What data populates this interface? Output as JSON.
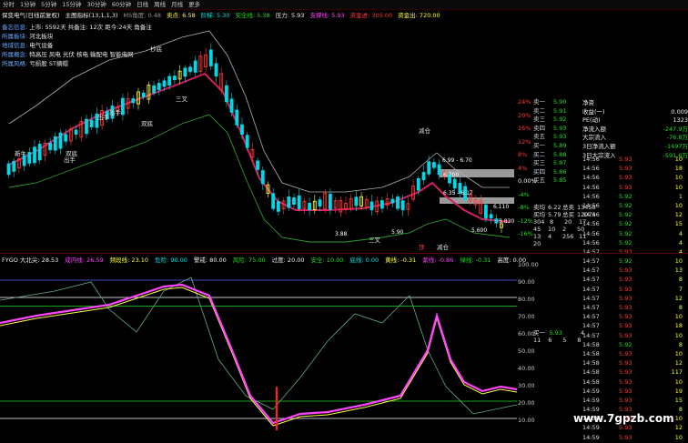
{
  "tabs": [
    "分时",
    "1分钟",
    "5分钟",
    "15分钟",
    "30分钟",
    "60分钟",
    "日线",
    "周线",
    "月线",
    "更多"
  ],
  "infobar": [
    {
      "text": "保变电气(日线前复权)",
      "c": "white"
    },
    {
      "text": "主图指标(13,1,1,3)",
      "c": "white"
    },
    {
      "text": "MS角度: 0.48",
      "c": "gray"
    },
    {
      "text": "卖点: 6.58",
      "c": "yellow"
    },
    {
      "text": "阶梯: 5.30",
      "c": "cyan"
    },
    {
      "text": "安全线: 5.38",
      "c": "green"
    },
    {
      "text": "压力: 5.93",
      "c": "white"
    },
    {
      "text": "支撑线: 5.93",
      "c": "magenta"
    },
    {
      "text": "资金进: 305.00",
      "c": "red"
    },
    {
      "text": "资金出: 720.00",
      "c": "yellow"
    }
  ],
  "notes": [
    {
      "k": "备忘信息:",
      "v": "上市: 5592天  共备注: 12次  距今:24天 角备注"
    },
    {
      "k": "所属板块:",
      "v": "河北板块"
    },
    {
      "k": "地域信息:",
      "v": "电气设备"
    },
    {
      "k": "所属概念:",
      "v": "特高压 风电 光伏 核电 输配电 智能电网"
    },
    {
      "k": "所属风格:",
      "v": "亏损股 ST摘帽"
    }
  ],
  "annotations": [
    "抄底",
    "三叉",
    "双底",
    "出手",
    "新牛",
    "双底",
    "出手",
    "出手",
    "减仓",
    "三叉",
    "顶",
    "减仓"
  ],
  "price_labels": [
    "6.99 - 6.70",
    "6.700",
    "6.35 - 6.17",
    "6.110",
    "5.830",
    "5.600",
    "3.88",
    "5.90"
  ],
  "pct_axis": [
    "24%",
    "20%",
    "16%",
    "12%",
    "8%",
    "4%",
    "0.00%",
    "-4%",
    "-8%",
    "-12%",
    "-16%"
  ],
  "book_sell": [
    {
      "label": "卖五",
      "price": "5.93"
    },
    {
      "label": "卖四",
      "price": "5.93"
    },
    {
      "label": "卖三",
      "price": "5.92"
    },
    {
      "label": "卖二",
      "price": "5.91"
    },
    {
      "label": "卖一",
      "price": "5.90"
    }
  ],
  "book_buy": [
    {
      "label": "买一",
      "price": "5.89"
    },
    {
      "label": "买二",
      "price": "5.88"
    },
    {
      "label": "买三",
      "price": "5.87"
    },
    {
      "label": "买四",
      "price": "5.86"
    },
    {
      "label": "买五",
      "price": "5.85"
    }
  ],
  "stats": [
    {
      "k": "净资",
      "v": ""
    },
    {
      "k": "收益(一)",
      "v": "0.009"
    },
    {
      "k": "PE(动)",
      "v": "1323"
    },
    {
      "k": "净流入额",
      "v": "-247.9万"
    },
    {
      "k": "大宗流入",
      "v": "-76.8万"
    },
    {
      "k": "3日净流入额",
      "v": "-1497万"
    },
    {
      "k": "3日大宗流入",
      "v": "-591.6万"
    }
  ],
  "summary": [
    {
      "a": "卖均",
      "b": "6.22",
      "c": "总卖",
      "d": "13458"
    },
    {
      "a": "买均",
      "b": "5.79",
      "c": "总买",
      "d": "12074"
    },
    {
      "a": "304",
      "b": "8",
      "c": "20",
      "d": "17"
    },
    {
      "a": "45",
      "b": "10",
      "c": "2",
      "d": "50"
    },
    {
      "a": "13",
      "b": "4",
      "c": "256",
      "d": "11"
    },
    {
      "a": "20",
      "b": "",
      "c": "",
      "d": ""
    }
  ],
  "bottom_left": [
    {
      "a": "买一",
      "b": "5.93",
      "c": "",
      "d": "4"
    },
    {
      "a": "11",
      "b": "6",
      "c": "5",
      "d": "8"
    }
  ],
  "ticks": [
    {
      "t": "14:56",
      "p": "5.93",
      "v": "10"
    },
    {
      "t": "14:56",
      "p": "5.93",
      "v": "18"
    },
    {
      "t": "14:56",
      "p": "5.93",
      "v": "10"
    },
    {
      "t": "14:56",
      "p": "5.93",
      "v": "10"
    },
    {
      "t": "14:56",
      "p": "5.92",
      "v": "1"
    },
    {
      "t": "14:56",
      "p": "5.92",
      "v": "10"
    },
    {
      "t": "14:56",
      "p": "5.92",
      "v": "12"
    },
    {
      "t": "14:56",
      "p": "5.92",
      "v": "15"
    },
    {
      "t": "14:56",
      "p": "5.92",
      "v": "4"
    },
    {
      "t": "14:56",
      "p": "5.92",
      "v": "4"
    },
    {
      "t": "14:57",
      "p": "5.93",
      "v": "4"
    },
    {
      "t": "14:57",
      "p": "5.92",
      "v": "10"
    },
    {
      "t": "14:57",
      "p": "5.93",
      "v": "13"
    },
    {
      "t": "14:57",
      "p": "5.93",
      "v": "8"
    },
    {
      "t": "14:57",
      "p": "5.93",
      "v": "7"
    },
    {
      "t": "14:57",
      "p": "5.93",
      "v": "12"
    },
    {
      "t": "14:57",
      "p": "5.93",
      "v": "8"
    },
    {
      "t": "14:57",
      "p": "5.93",
      "v": "10"
    },
    {
      "t": "14:57",
      "p": "5.93",
      "v": "18"
    },
    {
      "t": "14:57",
      "p": "5.93",
      "v": "10"
    },
    {
      "t": "14:58",
      "p": "5.92",
      "v": "8"
    },
    {
      "t": "14:58",
      "p": "5.93",
      "v": "10"
    },
    {
      "t": "14:58",
      "p": "5.93",
      "v": "12"
    },
    {
      "t": "14:58",
      "p": "5.93",
      "v": "117"
    },
    {
      "t": "14:58",
      "p": "5.93",
      "v": "10"
    },
    {
      "t": "14:59",
      "p": "5.93",
      "v": "19"
    },
    {
      "t": "14:59",
      "p": "5.93",
      "v": "15"
    },
    {
      "t": "14:59",
      "p": "5.93",
      "v": "8"
    },
    {
      "t": "14:59",
      "p": "5.93",
      "v": "10"
    },
    {
      "t": "14:59",
      "p": "5.93",
      "v": "12"
    },
    {
      "t": "14:59",
      "p": "5.93",
      "v": "10"
    }
  ],
  "osc_head": [
    {
      "text": "FYGO 大北尖: 28.53",
      "c": "white"
    },
    {
      "text": "成内线: 26.59",
      "c": "magenta"
    },
    {
      "text": "频段线: 23.10",
      "c": "yellow"
    },
    {
      "text": "危险: 90.00",
      "c": "cyan"
    },
    {
      "text": "警戒: 80.00",
      "c": "white"
    },
    {
      "text": "风险: 75.00",
      "c": "green"
    },
    {
      "text": "过度: 20.00",
      "c": "white"
    },
    {
      "text": "安全: 10.00",
      "c": "green"
    },
    {
      "text": "底线: 0.00",
      "c": "cyan"
    },
    {
      "text": "黄线: -0.31",
      "c": "yellow"
    },
    {
      "text": "紫线: -0.86",
      "c": "magenta"
    },
    {
      "text": "绿线: -0.31",
      "c": "green"
    },
    {
      "text": "高度: 0.00",
      "c": "white"
    }
  ],
  "osc_axis": [
    "100.00",
    "90.00",
    "80.00",
    "70.00",
    "60.00",
    "50.00",
    "40.00",
    "30.00",
    "20.00",
    "10.00"
  ],
  "watermark": "www.7gpzb.com",
  "colors": {
    "up": "#ff3a3a",
    "down": "#00d8e8",
    "ma1": "#d22060",
    "ma2": "#2f9b2f",
    "yellow": "#ffff44",
    "magenta": "#ff44ff",
    "green": "#22dd22"
  }
}
